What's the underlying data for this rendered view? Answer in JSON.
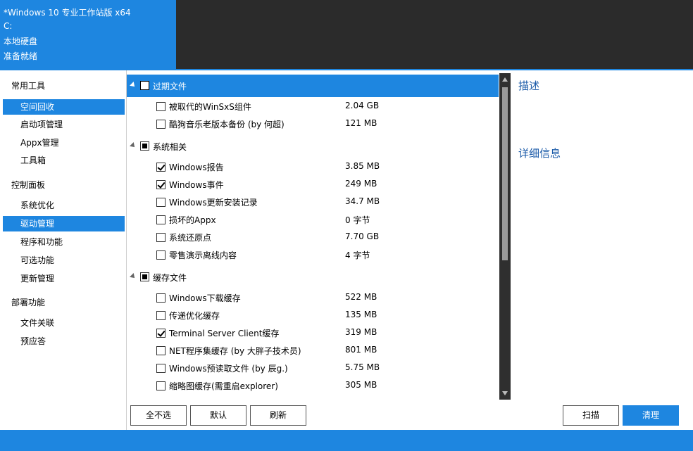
{
  "header": {
    "os_title": "*Windows 10 专业工作站版 x64",
    "drive": "C:",
    "disk": "本地硬盘",
    "status": "准备就绪"
  },
  "sidebar": {
    "sections": [
      {
        "label": "常用工具",
        "items": [
          "空间回收",
          "启动项管理",
          "Appx管理",
          "工具箱"
        ]
      },
      {
        "label": "控制面板",
        "items": [
          "系统优化",
          "驱动管理",
          "程序和功能",
          "可选功能",
          "更新管理"
        ]
      },
      {
        "label": "部署功能",
        "items": [
          "文件关联",
          "预应答"
        ]
      }
    ]
  },
  "tree": {
    "groups": [
      {
        "label": "过期文件",
        "state": "unchecked",
        "items": [
          {
            "label": "被取代的WinSxS组件",
            "size": "2.04 GB",
            "checked": false
          },
          {
            "label": "酷狗音乐老版本备份 (by 何超)",
            "size": "121 MB",
            "checked": false
          }
        ]
      },
      {
        "label": "系统相关",
        "state": "partial",
        "items": [
          {
            "label": "Windows报告",
            "size": "3.85 MB",
            "checked": true
          },
          {
            "label": "Windows事件",
            "size": "249 MB",
            "checked": true
          },
          {
            "label": "Windows更新安装记录",
            "size": "34.7 MB",
            "checked": false
          },
          {
            "label": "损坏的Appx",
            "size": "0 字节",
            "checked": false
          },
          {
            "label": "系统还原点",
            "size": "7.70 GB",
            "checked": false
          },
          {
            "label": "零售演示离线内容",
            "size": "4 字节",
            "checked": false
          }
        ]
      },
      {
        "label": "缓存文件",
        "state": "partial",
        "items": [
          {
            "label": "Windows下载缓存",
            "size": "522 MB",
            "checked": false
          },
          {
            "label": "传递优化缓存",
            "size": "135 MB",
            "checked": false
          },
          {
            "label": "Terminal Server Client缓存",
            "size": "319 MB",
            "checked": true
          },
          {
            "label": "NET程序集缓存 (by 大胖子技术员)",
            "size": "801 MB",
            "checked": false
          },
          {
            "label": "Windows预读取文件 (by 辰g.)",
            "size": "5.75 MB",
            "checked": false
          },
          {
            "label": "缩略图缓存(需重启explorer)",
            "size": "305 MB",
            "checked": false
          }
        ]
      }
    ]
  },
  "right_panel": {
    "description_title": "描述",
    "details_title": "详细信息"
  },
  "buttons": {
    "deselect_all": "全不选",
    "default": "默认",
    "refresh": "刷新",
    "scan": "扫描",
    "clean": "清理"
  },
  "colors": {
    "accent": "#1e86e0",
    "dark": "#2b2b2b"
  }
}
